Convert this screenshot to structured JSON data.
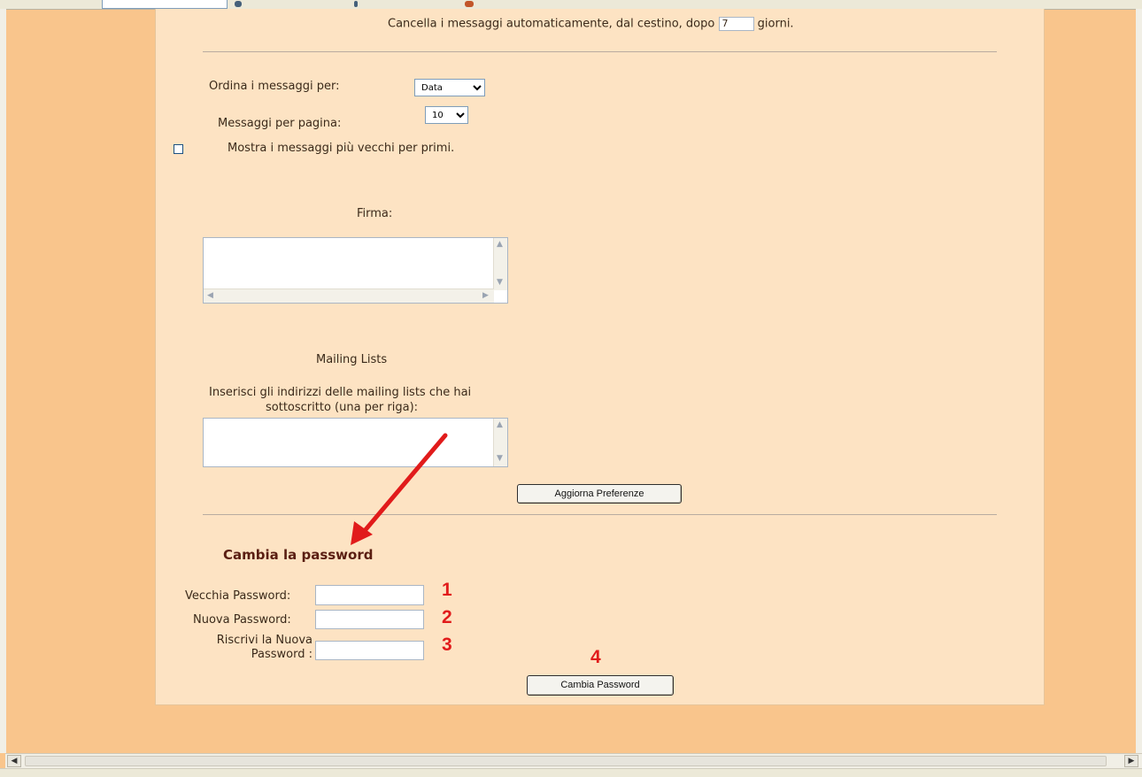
{
  "prefs": {
    "autodelete_prefix": "Cancella i messaggi automaticamente, dal cestino, dopo",
    "autodelete_days": "7",
    "autodelete_suffix": "giorni.",
    "sort_label": "Ordina i messaggi per:",
    "sort_selected": "Data",
    "per_page_label": "Messaggi per pagina:",
    "per_page_selected": "10",
    "oldest_first_label": "Mostra i messaggi più vecchi per primi.",
    "signature_label": "Firma:",
    "mailing_title": "Mailing Lists",
    "mailing_desc_line1": "Inserisci gli indirizzi delle mailing lists che hai",
    "mailing_desc_line2": "sottoscritto (una per riga):",
    "update_button": "Aggiorna Preferenze"
  },
  "password": {
    "heading": "Cambia la password",
    "old_label": "Vecchia Password:",
    "new_label": "Nuova Password:",
    "repeat_label_line1": "Riscrivi la Nuova",
    "repeat_label_line2": "Password :",
    "submit_button": "Cambia Password"
  },
  "annotations": {
    "step1": "1",
    "step2": "2",
    "step3": "3",
    "step4": "4",
    "arrow_color": "#e11b1b"
  },
  "colors": {
    "page_bg": "#f9c58c",
    "panel_bg": "#fde3c3",
    "annotation_red": "#e11b1b"
  }
}
